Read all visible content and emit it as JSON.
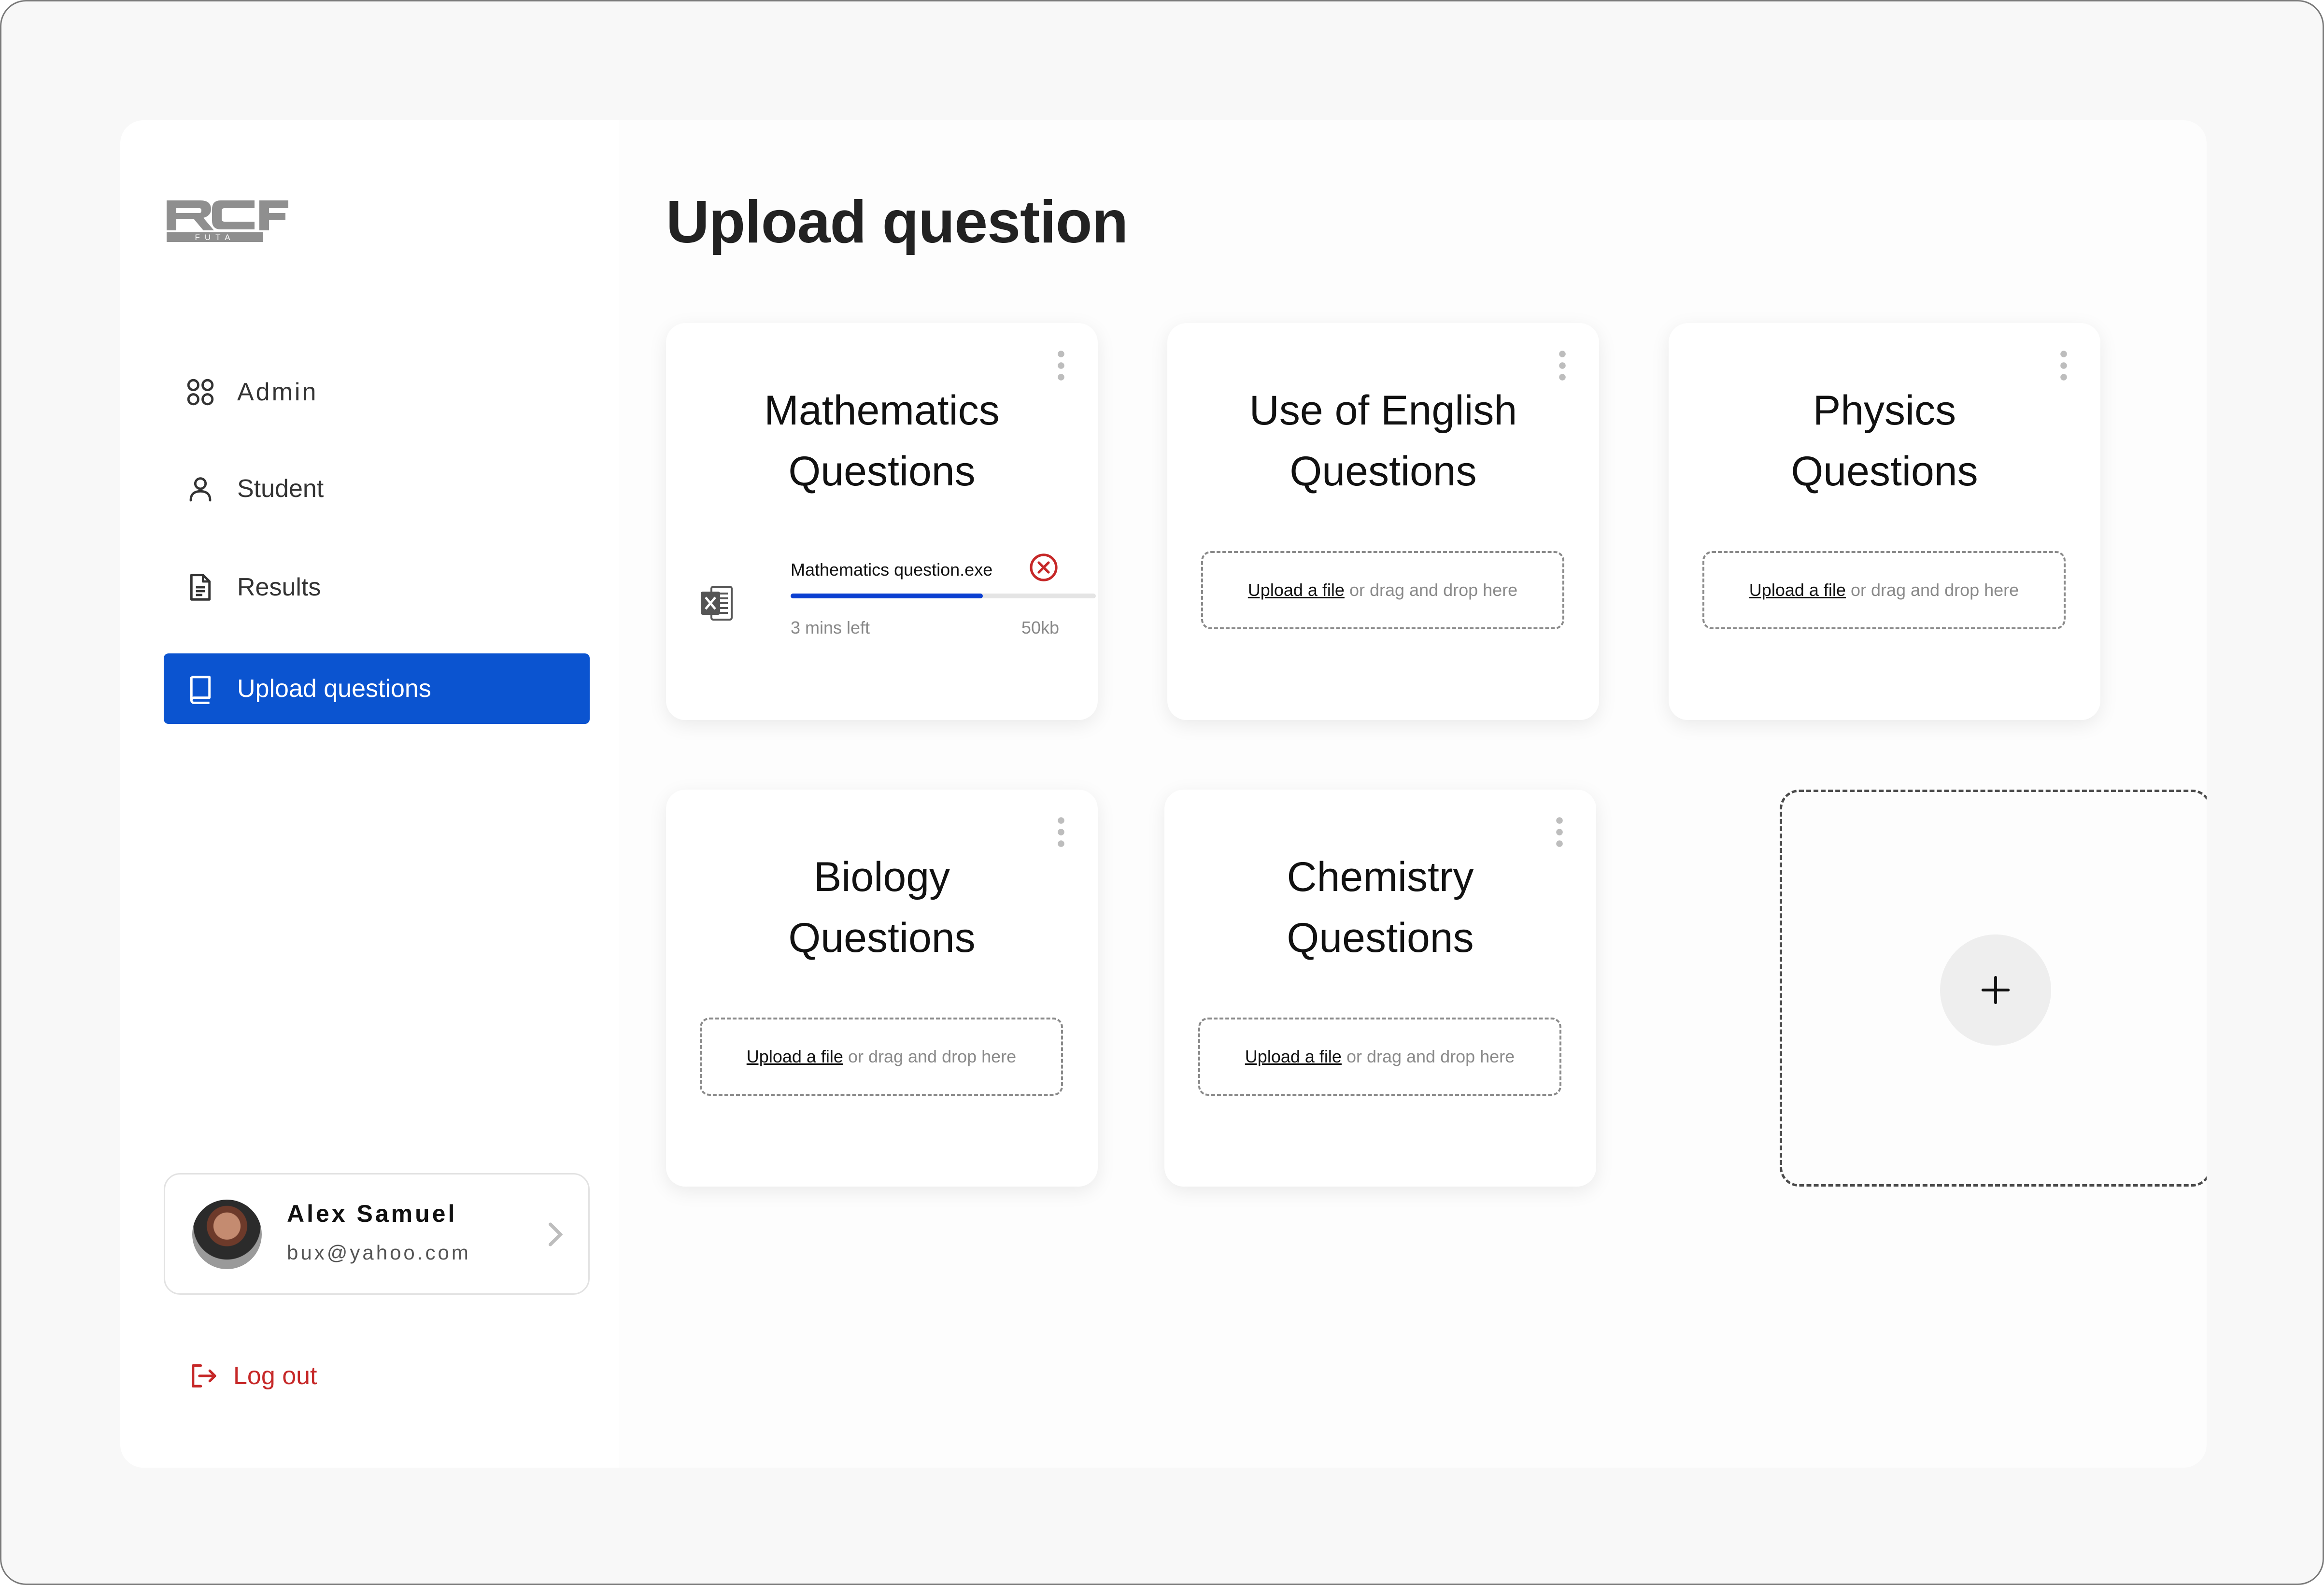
{
  "brand": {
    "logo_text": "RCF",
    "logo_subtext": "FUTA"
  },
  "sidebar": {
    "items": [
      {
        "label": "Admin",
        "icon": "grid-icon",
        "active": false
      },
      {
        "label": "Student",
        "icon": "user-icon",
        "active": false
      },
      {
        "label": "Results",
        "icon": "document-icon",
        "active": false
      },
      {
        "label": "Upload questions",
        "icon": "book-icon",
        "active": true
      }
    ],
    "user": {
      "name": "Alex Samuel",
      "email": "bux@yahoo.com"
    },
    "logout_label": "Log out"
  },
  "main": {
    "title": "Upload question",
    "cards": [
      {
        "title_line1": "Mathematics",
        "title_line2": "Questions",
        "upload": {
          "file_name": "Mathematics question.exe",
          "time_left": "3 mins left",
          "size": "50kb",
          "progress": 0.63
        }
      },
      {
        "title_line1": "Use of English",
        "title_line2": "Questions",
        "dropzone_link": "Upload a file",
        "dropzone_text": "or drag and drop here"
      },
      {
        "title_line1": "Physics",
        "title_line2": "Questions",
        "dropzone_link": "Upload a file",
        "dropzone_text": "or drag and drop here"
      },
      {
        "title_line1": "Biology",
        "title_line2": "Questions",
        "dropzone_link": "Upload a file",
        "dropzone_text": "or drag and drop here"
      },
      {
        "title_line1": "Chemistry",
        "title_line2": "Questions",
        "dropzone_link": "Upload a file",
        "dropzone_text": "or drag and drop here"
      }
    ],
    "add_card_icon": "plus-icon"
  },
  "colors": {
    "accent": "#0b54d0",
    "danger": "#c62828",
    "progress": "#0b3fd1"
  }
}
